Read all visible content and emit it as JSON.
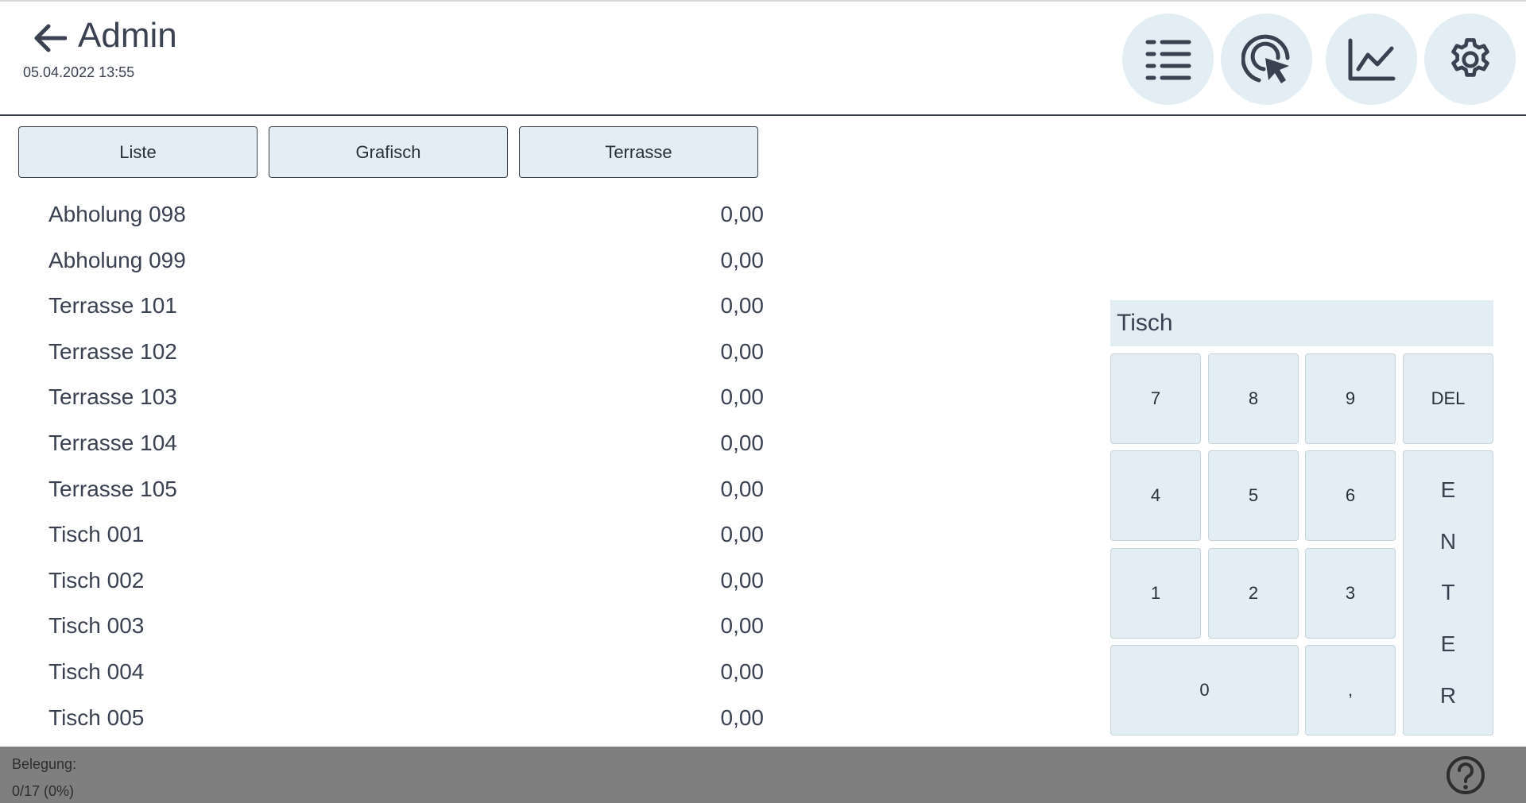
{
  "header": {
    "title": "Admin",
    "datetime": "05.04.2022  13:55",
    "icons": [
      "back-arrow-icon",
      "list-view-icon",
      "touch-target-icon",
      "chart-line-icon",
      "gear-icon"
    ]
  },
  "tabs": [
    {
      "label": "Liste"
    },
    {
      "label": "Grafisch"
    },
    {
      "label": "Terrasse"
    }
  ],
  "tables": [
    {
      "name": "Abholung 098",
      "amount": "0,00"
    },
    {
      "name": "Abholung 099",
      "amount": "0,00"
    },
    {
      "name": "Terrasse 101",
      "amount": "0,00"
    },
    {
      "name": "Terrasse 102",
      "amount": "0,00"
    },
    {
      "name": "Terrasse 103",
      "amount": "0,00"
    },
    {
      "name": "Terrasse 104",
      "amount": "0,00"
    },
    {
      "name": "Terrasse 105",
      "amount": "0,00"
    },
    {
      "name": "Tisch 001",
      "amount": "0,00"
    },
    {
      "name": "Tisch 002",
      "amount": "0,00"
    },
    {
      "name": "Tisch 003",
      "amount": "0,00"
    },
    {
      "name": "Tisch 004",
      "amount": "0,00"
    },
    {
      "name": "Tisch 005",
      "amount": "0,00"
    }
  ],
  "numpad": {
    "display": "Tisch",
    "keys": {
      "k7": "7",
      "k8": "8",
      "k9": "9",
      "del": "DEL",
      "k4": "4",
      "k5": "5",
      "k6": "6",
      "k1": "1",
      "k2": "2",
      "k3": "3",
      "k0": "0",
      "comma": ","
    },
    "enter_letters": [
      "E",
      "N",
      "T",
      "E",
      "R"
    ]
  },
  "footer": {
    "label": "Belegung:",
    "value": "0/17 (0%)",
    "help_icon": "question-circle-icon"
  },
  "colors": {
    "button_bg": "#e2eef4",
    "footer_bg": "#7f7f7f",
    "text": "#3a4150"
  }
}
